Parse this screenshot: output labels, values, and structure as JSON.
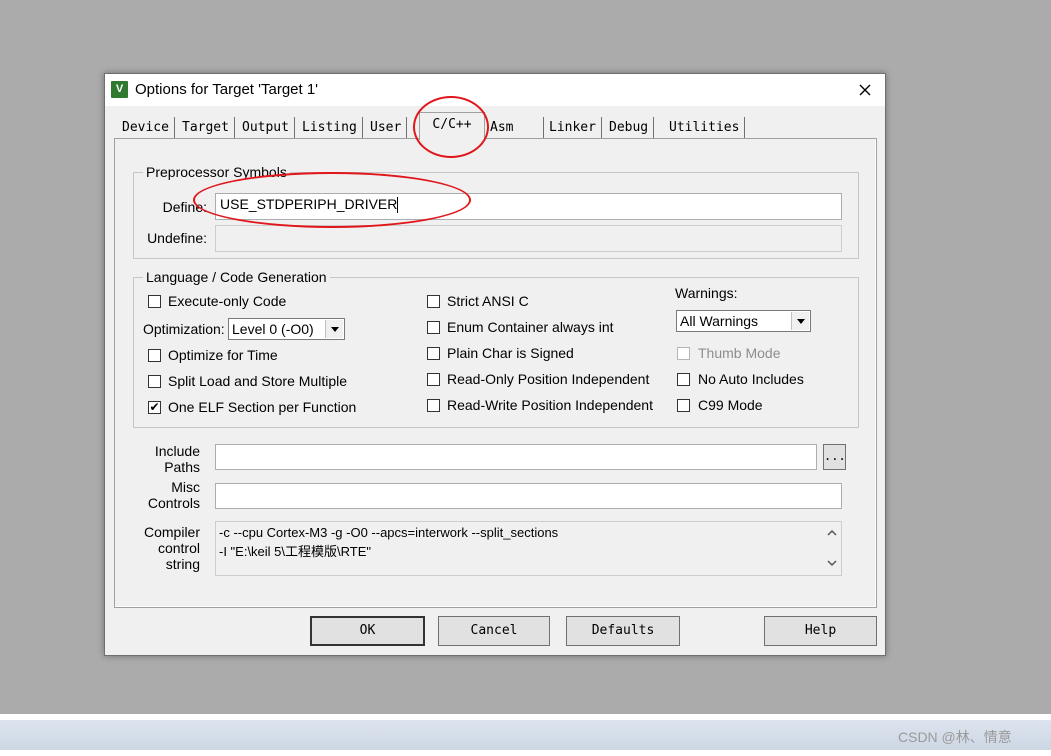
{
  "window": {
    "title": "Options for Target 'Target 1'",
    "app_icon_glyph": "V",
    "close_glyph": "✕"
  },
  "tabs": [
    {
      "label": "Device"
    },
    {
      "label": "Target"
    },
    {
      "label": "Output"
    },
    {
      "label": "Listing"
    },
    {
      "label": "User"
    },
    {
      "label": "C/C++",
      "active": true
    },
    {
      "label": "Asm"
    },
    {
      "label": "Linker"
    },
    {
      "label": "Debug"
    },
    {
      "label": "Utilities"
    }
  ],
  "preprocessor": {
    "group_label": "Preprocessor Symbols",
    "define_label": "Define:",
    "define_value": "USE_STDPERIPH_DRIVER",
    "undefine_label": "Undefine:",
    "undefine_value": ""
  },
  "language": {
    "group_label": "Language / Code Generation",
    "execute_only": {
      "label": "Execute-only Code",
      "checked": false
    },
    "optimization_label": "Optimization:",
    "optimization_value": "Level 0 (-O0)",
    "optimize_time": {
      "label": "Optimize for Time",
      "checked": false
    },
    "split_load": {
      "label": "Split Load and Store Multiple",
      "checked": false
    },
    "one_elf": {
      "label": "One ELF Section per Function",
      "checked": true
    },
    "strict_ansi": {
      "label": "Strict ANSI C",
      "checked": false
    },
    "enum_container": {
      "label": "Enum Container always int",
      "checked": false
    },
    "plain_char": {
      "label": "Plain Char is Signed",
      "checked": false
    },
    "ro_position": {
      "label": "Read-Only Position Independent",
      "checked": false
    },
    "rw_position": {
      "label": "Read-Write Position Independent",
      "checked": false
    },
    "warnings_label": "Warnings:",
    "warnings_value": "All Warnings",
    "thumb_mode": {
      "label": "Thumb Mode",
      "checked": false,
      "disabled": true
    },
    "no_auto_includes": {
      "label": "No Auto Includes",
      "checked": false
    },
    "c99_mode": {
      "label": "C99 Mode",
      "checked": false
    },
    "check_glyph": "✔"
  },
  "include": {
    "label_line1": "Include",
    "label_line2": "Paths",
    "value": "",
    "browse_label": "..."
  },
  "misc": {
    "label_line1": "Misc",
    "label_line2": "Controls",
    "value": ""
  },
  "compiler": {
    "label_line1": "Compiler",
    "label_line2": "control",
    "label_line3": "string",
    "line1": "-c --cpu Cortex-M3 -g -O0 --apcs=interwork --split_sections",
    "line2": "-I \"E:\\keil 5\\工程模版\\RTE\""
  },
  "buttons": {
    "ok": "OK",
    "cancel": "Cancel",
    "defaults": "Defaults",
    "help": "Help"
  },
  "watermark": "CSDN @林、情意",
  "colors": {
    "annotation": "#e0161b",
    "background": "#ababab",
    "dialog": "#f0f0f0"
  }
}
